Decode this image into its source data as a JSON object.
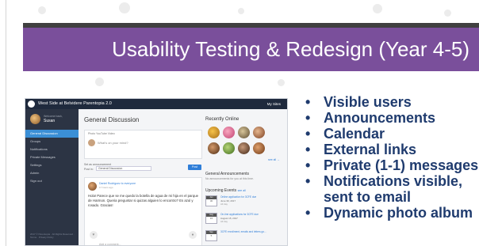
{
  "slide": {
    "title": "Usability Testing & Redesign (Year 4-5)",
    "colors": {
      "title_band": "#7a4f9b",
      "dark_band": "#404040",
      "bullet_text": "#1f3b6e"
    }
  },
  "screenshot": {
    "topbar": {
      "site_name": "West Side at Belvidere Parentopia 2.0",
      "my_sites": "My Sites"
    },
    "sidebar": {
      "welcome": "Welcome back,",
      "user_name": "Susan",
      "items": [
        "General Discussion",
        "Groups",
        "Notifications",
        "Private Messages",
        "Settings",
        "Admin",
        "Sign out"
      ],
      "footer": "2017 © Parentopia · All Rights Reserved · Terms · Privacy Policy"
    },
    "main": {
      "title": "General Discussion",
      "composer_tabs": "Photo   YouTube Video",
      "composer_placeholder": "What's on your mind?",
      "set_announcement": "Set as announcement",
      "post_in_label": "Post in:",
      "post_in_value": "General Discussion",
      "post_button": "Post",
      "post": {
        "author": "Daniel Rodriguez to everyone",
        "time": "17 hours ago",
        "body": "Hola! Parece que se me quedo la botella de agua de mi hija en el parque de Harmon. Queria preguntar si quizas alguien lo encontro? Es azul y rosado. Gracias!"
      },
      "add_comment": "Add a comment...",
      "heart_icon": "heart-icon",
      "comment_icon": "comment-icon"
    },
    "right": {
      "recently_online": "Recently Online",
      "see_all": "see all →",
      "general_announcements": "General Announcements",
      "no_announcements": "No announcements for you at this time.",
      "upcoming_events": "Upcoming Events",
      "upcoming_see_all": "see all",
      "events": [
        {
          "month": "Jun",
          "day": "30",
          "title": "Online application for 3CFE due",
          "date": "June 30, 2017",
          "time": "All day"
        },
        {
          "month": "Aug",
          "day": "15",
          "title": "On-line applications for 3CFE due",
          "date": "August 15, 2017",
          "time": "All day"
        },
        {
          "month": "Sep",
          "day": "5",
          "title": "3CFE enrollment, emails and letters go...",
          "date": "",
          "time": ""
        }
      ]
    }
  },
  "bullets": [
    "Visible users",
    "Announcements",
    "Calendar",
    "External links",
    "Private (1-1) messages",
    "Notifications visible, sent to email",
    "Dynamic photo album"
  ]
}
